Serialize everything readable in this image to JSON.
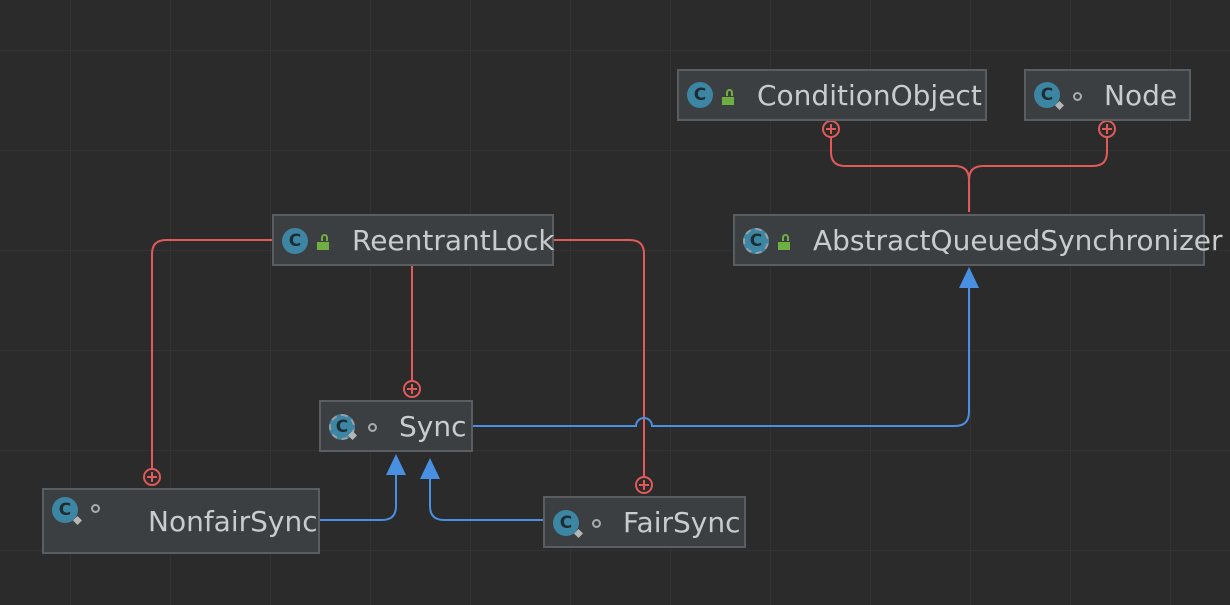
{
  "diagram": {
    "nodes": {
      "condition_object": {
        "label": "ConditionObject",
        "icon": "class-icon",
        "visibility": "public"
      },
      "node": {
        "label": "Node",
        "icon": "static-class-icon",
        "visibility": "package-private"
      },
      "reentrant_lock": {
        "label": "ReentrantLock",
        "icon": "class-icon",
        "visibility": "public"
      },
      "aqs": {
        "label": "AbstractQueuedSynchronizer",
        "icon": "abstract-class-icon",
        "visibility": "public"
      },
      "sync": {
        "label": "Sync",
        "icon": "abstract-static-class-icon",
        "visibility": "package-private"
      },
      "nonfair_sync": {
        "label": "NonfairSync",
        "icon": "static-class-icon",
        "visibility": "package-private"
      },
      "fair_sync": {
        "label": "FairSync",
        "icon": "static-class-icon",
        "visibility": "package-private"
      }
    },
    "icon_glyph": "C",
    "colors": {
      "inner_class_edge": "#e05a5a",
      "inheritance_edge": "#4a90e2",
      "background": "#2b2b2b",
      "node_fill": "#3c3f41"
    },
    "edges": [
      {
        "type": "inner-class",
        "from": "condition_object",
        "to": "aqs"
      },
      {
        "type": "inner-class",
        "from": "node",
        "to": "aqs"
      },
      {
        "type": "inner-class",
        "from": "sync",
        "to": "reentrant_lock"
      },
      {
        "type": "inner-class",
        "from": "nonfair_sync",
        "to": "reentrant_lock"
      },
      {
        "type": "inner-class",
        "from": "fair_sync",
        "to": "reentrant_lock"
      },
      {
        "type": "inheritance",
        "from": "sync",
        "to": "aqs"
      },
      {
        "type": "inheritance",
        "from": "nonfair_sync",
        "to": "sync"
      },
      {
        "type": "inheritance",
        "from": "fair_sync",
        "to": "sync"
      }
    ]
  }
}
